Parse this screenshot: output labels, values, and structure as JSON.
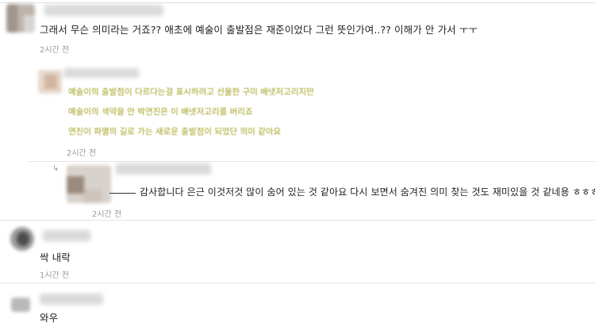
{
  "comments": [
    {
      "text": "그래서 무슨 의미라는 거죠?? 애초에 예술이 출발점은 재준이었다 그런 뜻인가여..?? 이해가 안 가서 ㅜㅜ",
      "time": "2시간 전"
    },
    {
      "lines": [
        "예술이의 출발점이 다르다는걸 표시하려고 선물한 구미 배넷저고리지만",
        "예술이의 색약을 안 박연진은 이 배넷저고리를 버리죠",
        "연진이 파멸의 길로 가는 새로운 출발점이 되었단 의미 같아요"
      ],
      "time": "2시간 전"
    },
    {
      "text": "감사합니다 은근 이것저것 많이 숨어 있는 것 같아요 다시 보면서 숨겨진 의미 찾는 것도 재미있을 것 같네용 ㅎㅎㅎ",
      "time": "2시간 전"
    },
    {
      "text": "싹 내락",
      "time": "1시간 전"
    },
    {
      "text": "와우"
    }
  ]
}
